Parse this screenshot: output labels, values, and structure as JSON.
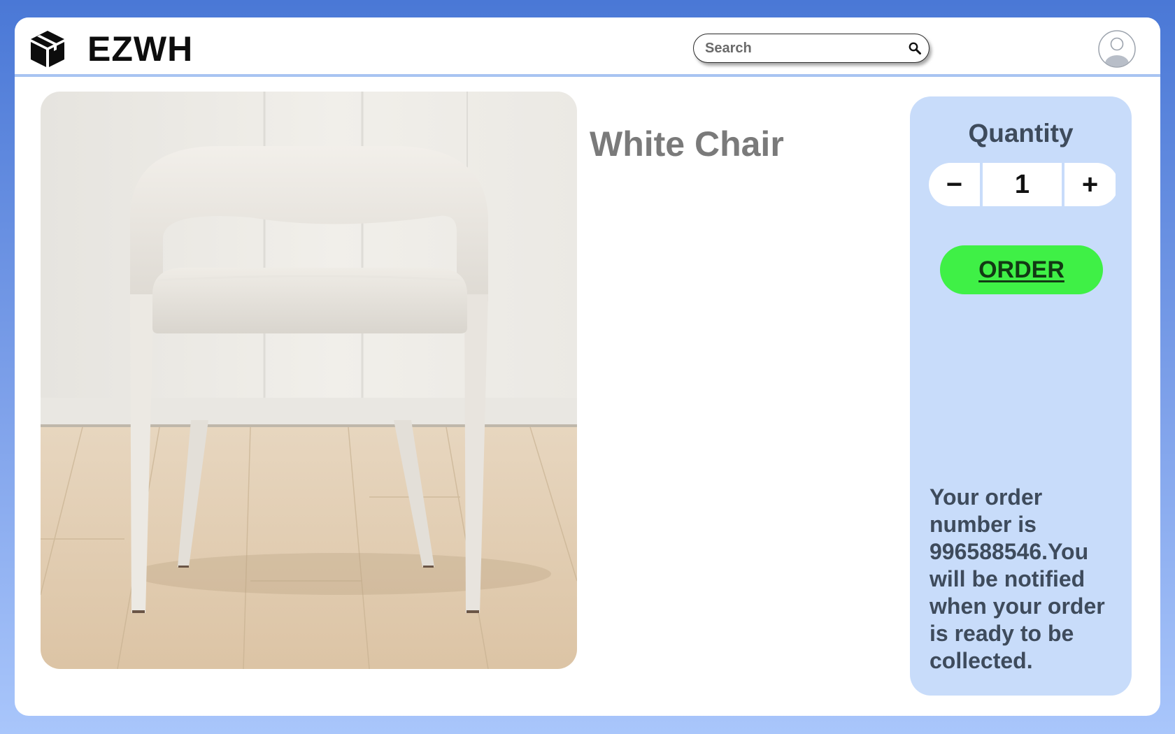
{
  "header": {
    "brand": "EZWH",
    "search": {
      "placeholder": "Search",
      "value": ""
    },
    "icons": {
      "logo": "box-icon",
      "search": "search-icon",
      "account": "user-avatar-icon"
    }
  },
  "product": {
    "title": "White Chair",
    "image": "white-chair-photo"
  },
  "order_panel": {
    "quantity_label": "Quantity",
    "decrement_label": "−",
    "quantity_value": "1",
    "increment_label": "+",
    "order_button_label": "ORDER",
    "message": "Your order number is 996588546.You will be notified when your order is ready to be collected."
  },
  "colors": {
    "background_top": "#4a78d6",
    "background_bottom": "#a9c6fb",
    "header_divider": "#a8c4f2",
    "panel": "#c8dcfa",
    "order_button": "#3ff046",
    "panel_text": "#3e4b5c",
    "title_text": "#7a7a7a"
  }
}
